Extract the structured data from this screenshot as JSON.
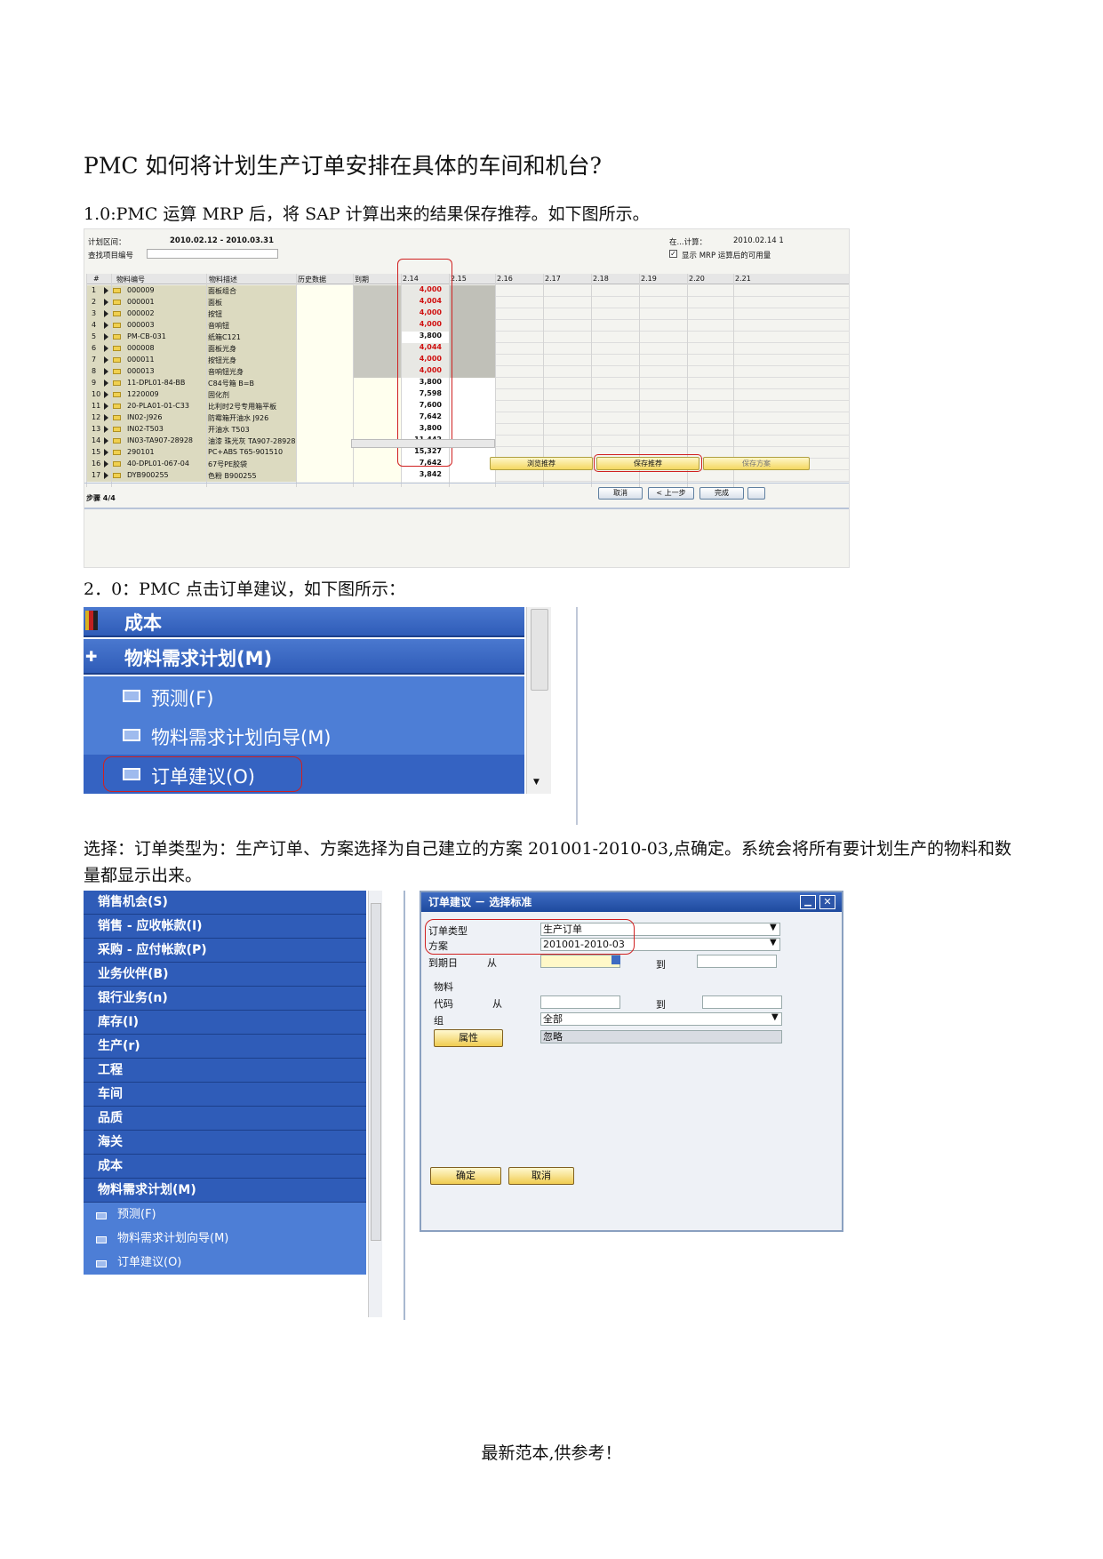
{
  "doc": {
    "title": "PMC 如何将计划生产订单安排在具体的车间和机台?",
    "step1": "1.0:PMC 运算 MRP 后，将 SAP 计算出来的结果保存推荐。如下图所示。",
    "step2": "2．0：PMC 点击订单建议，如下图所示：",
    "step3": "选择：订单类型为：生产订单、方案选择为自己建立的方案 201001-2010-03,点确定。系统会将所有要计划生产的物料和数量都显示出来。",
    "footer": "最新范本,供参考！"
  },
  "shot1": {
    "period_label": "计划区间：",
    "period_value": "2010.02.12  -  2010.03.31",
    "search_label": "查找项目编号",
    "calc_label": "在...计算：",
    "calc_value": "2010.02.14  1",
    "check_label": "显示 MRP 运算后的可用量",
    "headers": [
      "#",
      "物料编号",
      "物料描述",
      "历史数据",
      "到期",
      "2.14",
      "2.15",
      "2.16",
      "2.17",
      "2.18",
      "2.19",
      "2.20",
      "2.21"
    ],
    "rows": [
      {
        "n": "1",
        "code": "000009",
        "desc": "面板组合",
        "qty": "4,000",
        "red": true
      },
      {
        "n": "2",
        "code": "000001",
        "desc": "面板",
        "qty": "4,004",
        "red": true
      },
      {
        "n": "3",
        "code": "000002",
        "desc": "按钮",
        "qty": "4,000",
        "red": true
      },
      {
        "n": "4",
        "code": "000003",
        "desc": "音响钮",
        "qty": "4,000",
        "red": true
      },
      {
        "n": "5",
        "code": "PM-CB-031",
        "desc": "纸箱C121",
        "qty": "3,800",
        "red": false
      },
      {
        "n": "6",
        "code": "000008",
        "desc": "面板光身",
        "qty": "4,044",
        "red": true
      },
      {
        "n": "7",
        "code": "000011",
        "desc": "按钮光身",
        "qty": "4,000",
        "red": true
      },
      {
        "n": "8",
        "code": "000013",
        "desc": "音响钮光身",
        "qty": "4,000",
        "red": true
      },
      {
        "n": "9",
        "code": "11-DPL01-84-BB",
        "desc": "C84号箱 B=B",
        "qty": "3,800",
        "red": false
      },
      {
        "n": "10",
        "code": "1220009",
        "desc": "固化剂",
        "qty": "7,598",
        "red": false
      },
      {
        "n": "11",
        "code": "20-PLA01-01-C33",
        "desc": "比利时2号专用箱平板",
        "qty": "7,600",
        "red": false
      },
      {
        "n": "12",
        "code": "IN02-J926",
        "desc": "防霉箱开油水 J926",
        "qty": "7,642",
        "red": false
      },
      {
        "n": "13",
        "code": "IN02-T503",
        "desc": "开油水 T503",
        "qty": "3,800",
        "red": false
      },
      {
        "n": "14",
        "code": "IN03-TA907-28928",
        "desc": "油漆 珠光灰 TA907-28928",
        "qty": "11,442",
        "red": false
      },
      {
        "n": "15",
        "code": "290101",
        "desc": "PC+ABS T65-901510",
        "qty": "15,327",
        "red": false
      },
      {
        "n": "16",
        "code": "40-DPL01-067-04",
        "desc": "67号PE胶袋",
        "qty": "7,642",
        "red": false
      },
      {
        "n": "17",
        "code": "DYB900255",
        "desc": "色粉 B900255",
        "qty": "3,842",
        "red": false
      }
    ],
    "buttons": {
      "browse": "浏览推荐",
      "save": "保存推荐",
      "save_plan": "保存方案"
    },
    "step_label": "步骤 4/4",
    "nav": {
      "cancel": "取消",
      "prev": "< 上一步",
      "finish": "完成"
    }
  },
  "shot2": {
    "cost": "成本",
    "mrp": "物料需求计划(M)",
    "forecast": "预测(F)",
    "wizard": "物料需求计划向导(M)",
    "order": "订单建议(O)"
  },
  "shot3": {
    "menu": [
      "销售机会(S)",
      "销售 - 应收帐款(I)",
      "采购 - 应付帐款(P)",
      "业务伙伴(B)",
      "银行业务(n)",
      "库存(I)",
      "生产(r)",
      "工程",
      "车间",
      "品质",
      "海关",
      "成本",
      "物料需求计划(M)"
    ],
    "sub": [
      "预测(F)",
      "物料需求计划向导(M)",
      "订单建议(O)"
    ],
    "dialog": {
      "title": "订单建议  － 选择标准",
      "order_type_label": "订单类型",
      "order_type_value": "生产订单",
      "plan_label": "方案",
      "plan_value": "201001-2010-03",
      "due_label": "到期日",
      "from": "从",
      "to": "到",
      "material": "物料",
      "code": "代码",
      "group": "组",
      "group_value": "全部",
      "attr_button": "属性",
      "attr_value": "忽略",
      "ok": "确定",
      "cancel": "取消"
    }
  }
}
